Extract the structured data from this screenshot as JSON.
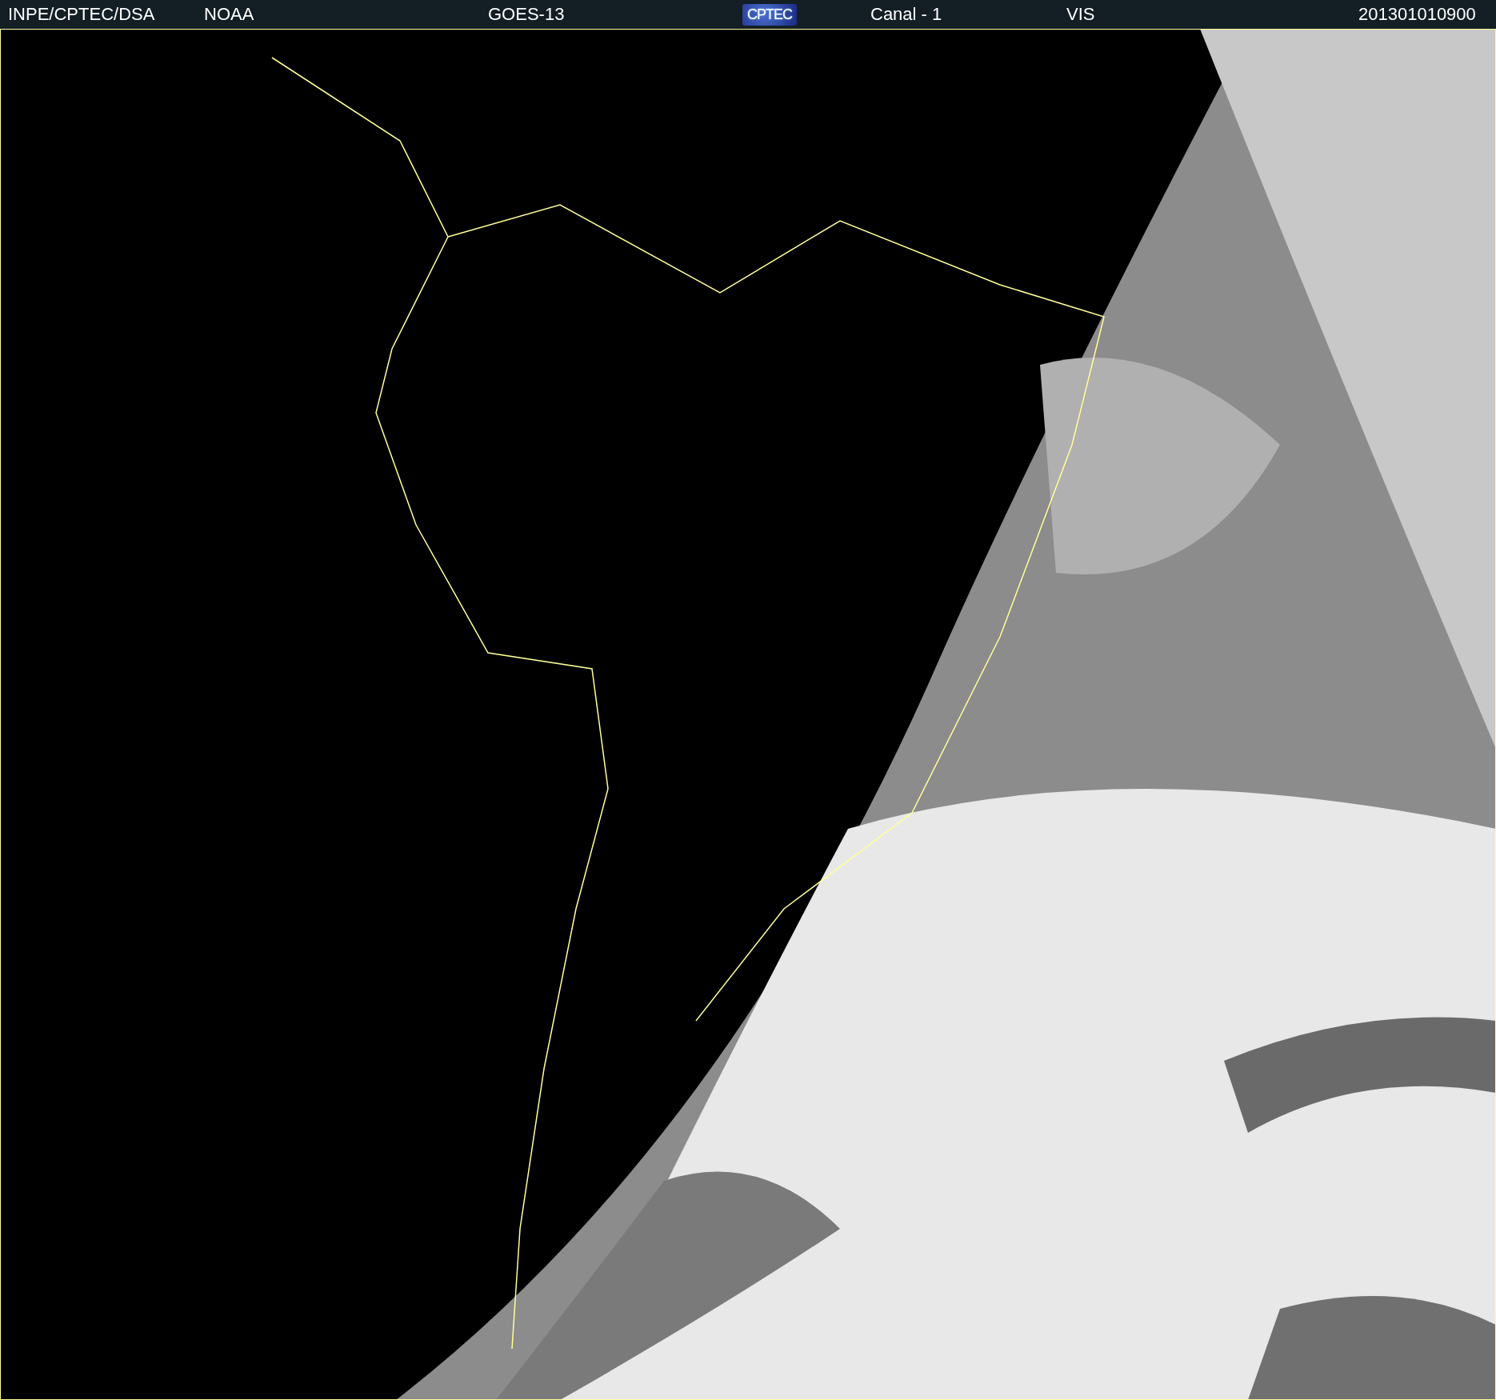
{
  "header": {
    "items": [
      {
        "kind": "text",
        "text": "INPE/CPTEC/DSA"
      },
      {
        "kind": "text",
        "text": "NOAA"
      },
      {
        "kind": "text",
        "text": "GOES-13"
      },
      {
        "kind": "logo",
        "text": "CPTEC"
      },
      {
        "kind": "text",
        "text": "Canal - 1"
      },
      {
        "kind": "text",
        "text": "VIS"
      },
      {
        "kind": "text",
        "text": "201301010900"
      }
    ]
  }
}
